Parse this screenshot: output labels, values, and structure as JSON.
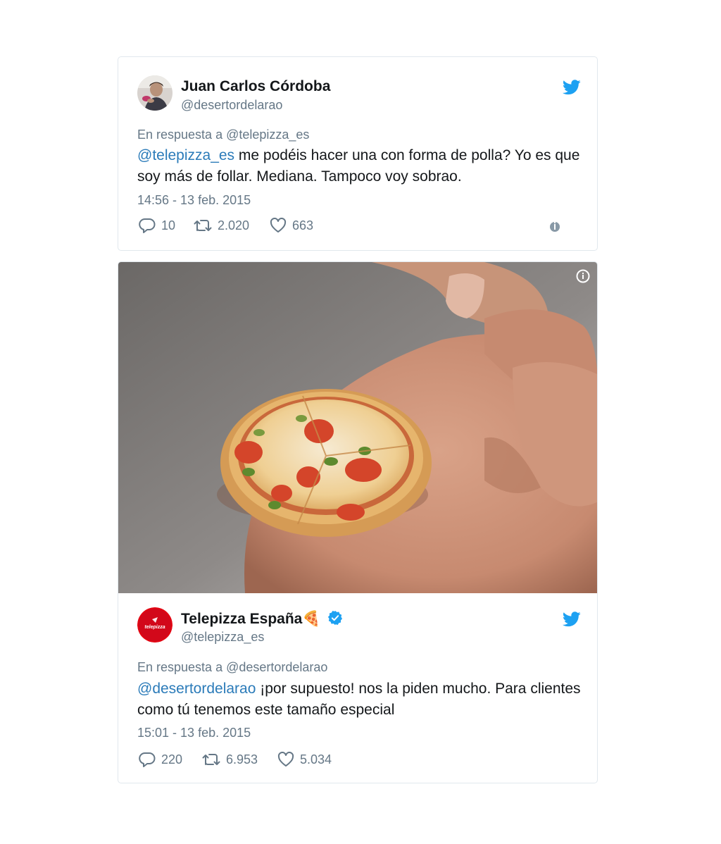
{
  "tweets": [
    {
      "author_name": "Juan Carlos Córdoba",
      "author_handle": "@desertordelarao",
      "reply_prefix": "En respuesta a",
      "reply_to": "@telepizza_es",
      "text_mention": "@telepizza_es",
      "text_body": " me podéis hacer una con forma de polla? Yo es que soy más de follar. Mediana. Tampoco voy sobrao.",
      "timestamp": "14:56 - 13 feb. 2015",
      "replies": "10",
      "retweets": "2.020",
      "likes": "663",
      "avatar_icon": "user-photo-avatar"
    },
    {
      "author_name": "Telepizza España",
      "author_emoji": "🍕",
      "author_handle": "@telepizza_es",
      "reply_prefix": "En respuesta a",
      "reply_to": "@desertordelarao",
      "text_mention": "@desertordelarao",
      "text_body": " ¡por supuesto! nos la piden mucho. Para clientes como tú tenemos este tamaño especial",
      "timestamp": "15:01 - 13 feb. 2015",
      "replies": "220",
      "retweets": "6.953",
      "likes": "5.034",
      "avatar_logo_text": "telepizza",
      "verified_icon": "verified-badge-icon"
    }
  ],
  "colors": {
    "twitter_blue": "#1da1f2",
    "mention_blue": "#2b7bb9",
    "secondary_gray": "#657786",
    "telepizza_red": "#e30613"
  },
  "icons": {
    "brand": "twitter-bird-icon",
    "reply": "reply-icon",
    "retweet": "retweet-icon",
    "like": "heart-icon",
    "info": "info-icon"
  }
}
